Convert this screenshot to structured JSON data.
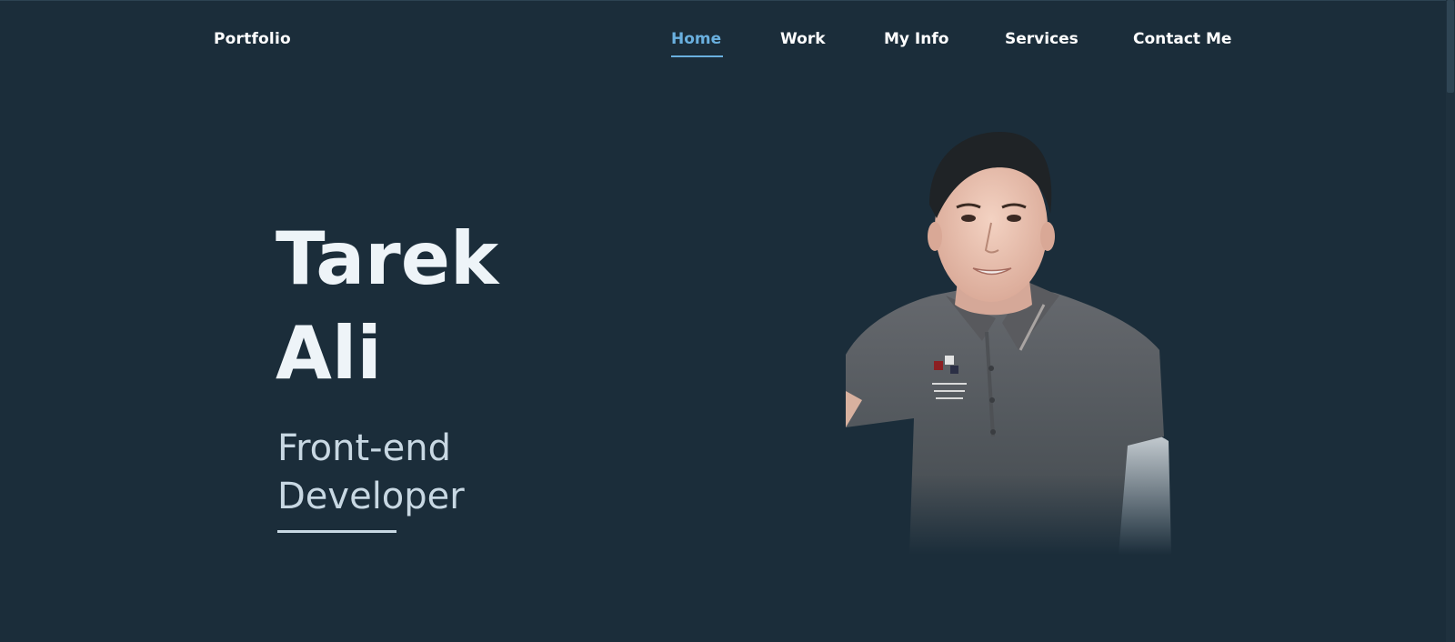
{
  "nav": {
    "logo": "Portfolio",
    "links": [
      {
        "label": "Home",
        "active": true
      },
      {
        "label": "Work",
        "active": false
      },
      {
        "label": "My Info",
        "active": false
      },
      {
        "label": "Services",
        "active": false
      },
      {
        "label": "Contact Me",
        "active": false
      }
    ]
  },
  "hero": {
    "first_name": "Tarek",
    "last_name": "Ali",
    "role_line1": "Front-end",
    "role_line2": "Developer"
  },
  "colors": {
    "background": "#1b2d3a",
    "accent": "#6ab0df",
    "text": "#ffffff",
    "subtext": "#c8d8e3"
  }
}
